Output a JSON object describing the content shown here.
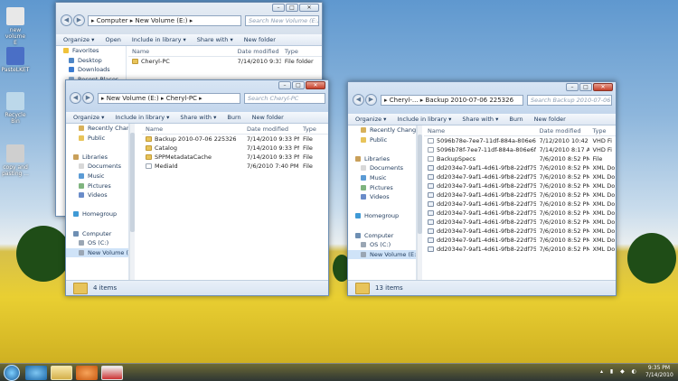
{
  "desktop": {
    "icons": [
      {
        "label": "new volume\nE",
        "icon": "drive-shortcut-icon"
      },
      {
        "label": "PasteLKET",
        "icon": "program-icon"
      },
      {
        "label": "Recycle Bin",
        "icon": "recycle-bin-icon"
      },
      {
        "label": "copy and\npasting ...",
        "icon": "shortcut-icon"
      }
    ]
  },
  "window_computer": {
    "address": [
      "Computer",
      "New Volume (E:)"
    ],
    "search_placeholder": "Search New Volume (E:)",
    "toolbar": [
      "Organize ▾",
      "Open",
      "Include in library ▾",
      "Share with ▾",
      "New folder"
    ],
    "nav": [
      {
        "label": "Favorites",
        "icon": "star-icon"
      },
      {
        "label": "Desktop",
        "icon": "desktop-icon"
      },
      {
        "label": "Downloads",
        "icon": "downloads-icon"
      },
      {
        "label": "Recent Places",
        "icon": "recent-places-icon"
      }
    ],
    "columns": [
      "Name",
      "Date modified",
      "Type"
    ],
    "rows": [
      {
        "name": "Cheryl-PC",
        "date": "7/14/2010 9:33 PM",
        "type": "File folder",
        "kind": "folder"
      }
    ]
  },
  "window_cherylpc": {
    "address": [
      "New Volume (E:)",
      "Cheryl-PC"
    ],
    "search_placeholder": "Search Cheryl-PC",
    "toolbar": [
      "Organize ▾",
      "Include in library ▾",
      "Share with ▾",
      "Burn",
      "New folder"
    ],
    "nav": [
      {
        "label": "Recently Changed",
        "icon": "recently-changed-icon"
      },
      {
        "label": "Public",
        "icon": "folder-icon"
      },
      {
        "label": "",
        "icon": ""
      },
      {
        "label": "Libraries",
        "icon": "libraries-icon"
      },
      {
        "label": "Documents",
        "icon": "documents-icon"
      },
      {
        "label": "Music",
        "icon": "music-icon"
      },
      {
        "label": "Pictures",
        "icon": "pictures-icon"
      },
      {
        "label": "Videos",
        "icon": "videos-icon"
      },
      {
        "label": "",
        "icon": ""
      },
      {
        "label": "Homegroup",
        "icon": "homegroup-icon"
      },
      {
        "label": "",
        "icon": ""
      },
      {
        "label": "Computer",
        "icon": "computer-icon"
      },
      {
        "label": "OS (C:)",
        "icon": "drive-icon"
      },
      {
        "label": "New Volume (E:)",
        "icon": "drive-icon"
      }
    ],
    "selected_nav": 13,
    "columns": [
      "Name",
      "Date modified",
      "Type"
    ],
    "rows": [
      {
        "name": "Backup 2010-07-06 225326",
        "date": "7/14/2010 9:33 PM",
        "type": "File",
        "kind": "folder"
      },
      {
        "name": "Catalog",
        "date": "7/14/2010 9:33 PM",
        "type": "File",
        "kind": "folder"
      },
      {
        "name": "SPPMetadataCache",
        "date": "7/14/2010 9:33 PM",
        "type": "File",
        "kind": "folder"
      },
      {
        "name": "MediaId",
        "date": "7/6/2010 7:40 PM",
        "type": "File",
        "kind": "file"
      }
    ],
    "status": "4 items"
  },
  "window_backup": {
    "address": [
      "Cheryl-...",
      "Backup 2010-07-06 225326"
    ],
    "search_placeholder": "Search Backup 2010-07-06 225326",
    "toolbar": [
      "Organize ▾",
      "Include in library ▾",
      "Share with ▾",
      "Burn",
      "New folder"
    ],
    "nav": [
      {
        "label": "Recently Changed",
        "icon": "recently-changed-icon"
      },
      {
        "label": "Public",
        "icon": "folder-icon"
      },
      {
        "label": "",
        "icon": ""
      },
      {
        "label": "Libraries",
        "icon": "libraries-icon"
      },
      {
        "label": "Documents",
        "icon": "documents-icon"
      },
      {
        "label": "Music",
        "icon": "music-icon"
      },
      {
        "label": "Pictures",
        "icon": "pictures-icon"
      },
      {
        "label": "Videos",
        "icon": "videos-icon"
      },
      {
        "label": "",
        "icon": ""
      },
      {
        "label": "Homegroup",
        "icon": "homegroup-icon"
      },
      {
        "label": "",
        "icon": ""
      },
      {
        "label": "Computer",
        "icon": "computer-icon"
      },
      {
        "label": "OS (C:)",
        "icon": "drive-icon"
      },
      {
        "label": "New Volume (E:)",
        "icon": "drive-icon"
      }
    ],
    "selected_nav": 13,
    "columns": [
      "Name",
      "Date modified",
      "Type"
    ],
    "rows": [
      {
        "name": "5096b78e-7ee7-11df-884a-806e6f6e6963...",
        "date": "7/12/2010 10:42 PM",
        "type": "VHD Fi",
        "kind": "file"
      },
      {
        "name": "5096b78f-7ee7-11df-884a-806e6f6e6963...",
        "date": "7/14/2010 8:17 AM",
        "type": "VHD Fi",
        "kind": "file"
      },
      {
        "name": "BackupSpecs",
        "date": "7/6/2010 8:52 PM",
        "type": "File",
        "kind": "file"
      },
      {
        "name": "dd2034e7-9af1-4d61-9fb8-22df7580978...",
        "date": "7/6/2010 8:52 PM",
        "type": "XML Do",
        "kind": "xml"
      },
      {
        "name": "dd2034e7-9af1-4d61-9fb8-22df7580978...",
        "date": "7/6/2010 8:52 PM",
        "type": "XML Do",
        "kind": "xml"
      },
      {
        "name": "dd2034e7-9af1-4d61-9fb8-22df7580978...",
        "date": "7/6/2010 8:52 PM",
        "type": "XML Do",
        "kind": "xml"
      },
      {
        "name": "dd2034e7-9af1-4d61-9fb8-22df7580978...",
        "date": "7/6/2010 8:52 PM",
        "type": "XML Do",
        "kind": "xml"
      },
      {
        "name": "dd2034e7-9af1-4d61-9fb8-22df7580978...",
        "date": "7/6/2010 8:52 PM",
        "type": "XML Do",
        "kind": "xml"
      },
      {
        "name": "dd2034e7-9af1-4d61-9fb8-22df7580978...",
        "date": "7/6/2010 8:52 PM",
        "type": "XML Do",
        "kind": "xml"
      },
      {
        "name": "dd2034e7-9af1-4d61-9fb8-22df7580978...",
        "date": "7/6/2010 8:52 PM",
        "type": "XML Do",
        "kind": "xml"
      },
      {
        "name": "dd2034e7-9af1-4d61-9fb8-22df7580978...",
        "date": "7/6/2010 8:52 PM",
        "type": "XML Do",
        "kind": "xml"
      },
      {
        "name": "dd2034e7-9af1-4d61-9fb8-22df7580978...",
        "date": "7/6/2010 8:52 PM",
        "type": "XML Do",
        "kind": "xml"
      },
      {
        "name": "dd2034e7-9af1-4d61-9fb8-22df7580978...",
        "date": "7/6/2010 8:52 PM",
        "type": "XML Do",
        "kind": "xml"
      }
    ],
    "status": "13 items"
  },
  "taskbar": {
    "time": "9:35 PM",
    "date": "7/14/2010",
    "apps": [
      "internet-explorer-icon",
      "windows-explorer-icon",
      "media-player-icon",
      "snipping-tool-icon"
    ]
  },
  "colors": {
    "accent": "#1e395b",
    "selection": "#cfe3f8",
    "folder": "#e8c45a"
  }
}
